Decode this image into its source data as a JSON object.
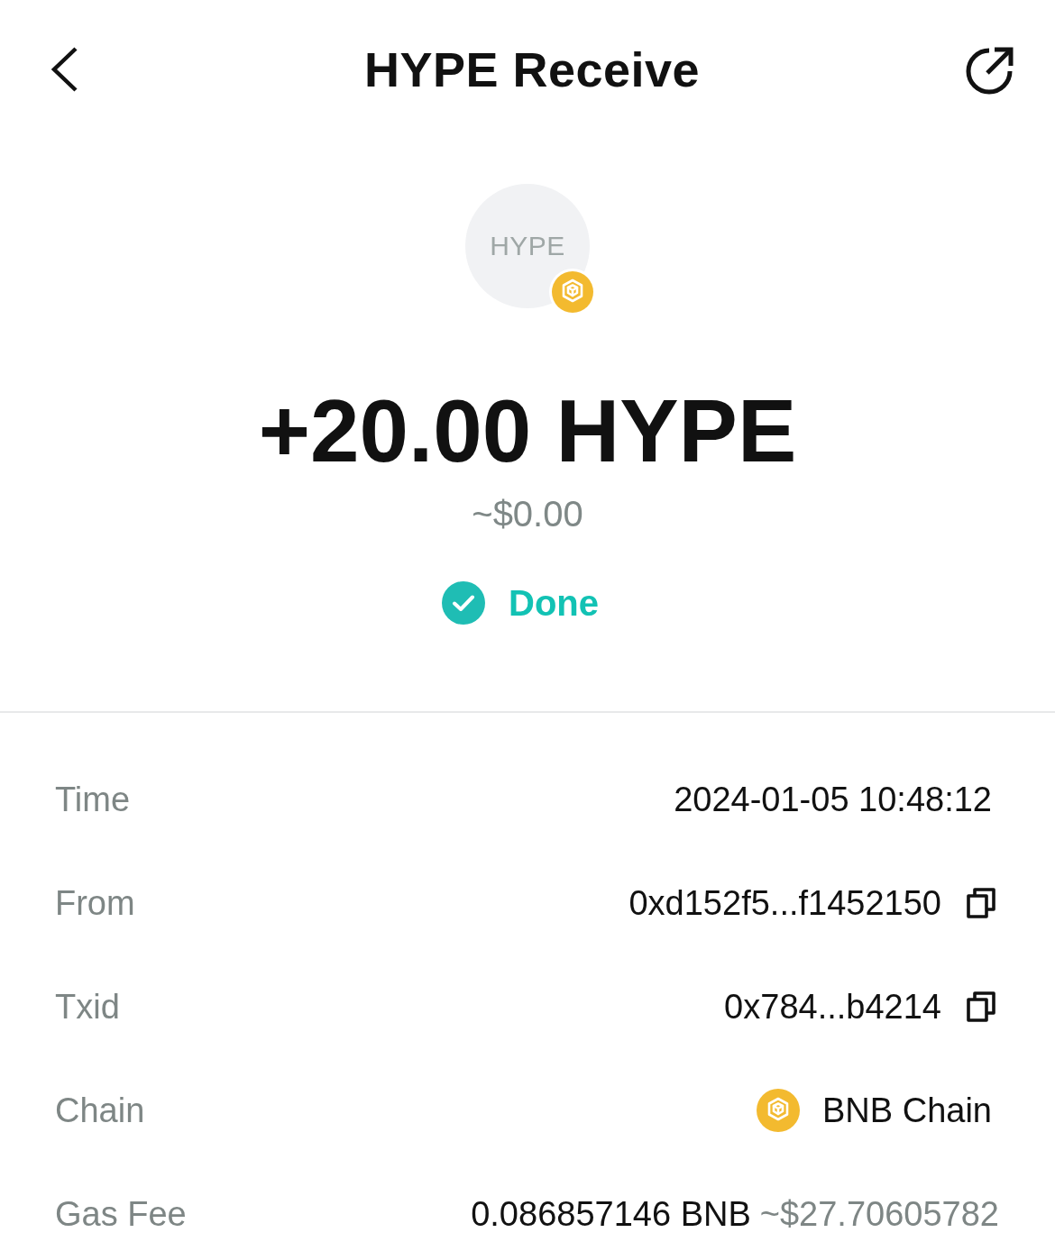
{
  "header": {
    "title": "HYPE Receive"
  },
  "asset": {
    "symbol": "HYPE",
    "amount": "+20.00 HYPE",
    "fiat_value": "~$0.00",
    "status": {
      "kind": "done",
      "label": "Done"
    }
  },
  "details": [
    {
      "kind": "text",
      "label": "Time",
      "value": "2024-01-05 10:48:12"
    },
    {
      "kind": "copy",
      "label": "From",
      "value": "0xd152f5...f1452150"
    },
    {
      "kind": "copy",
      "label": "Txid",
      "value": "0x784...b4214"
    },
    {
      "kind": "chain",
      "label": "Chain",
      "value": "BNB Chain"
    },
    {
      "kind": "fee",
      "label": "Gas Fee",
      "value": "0.086857146 BNB",
      "fiat_value": "~$27.70605782"
    }
  ]
}
